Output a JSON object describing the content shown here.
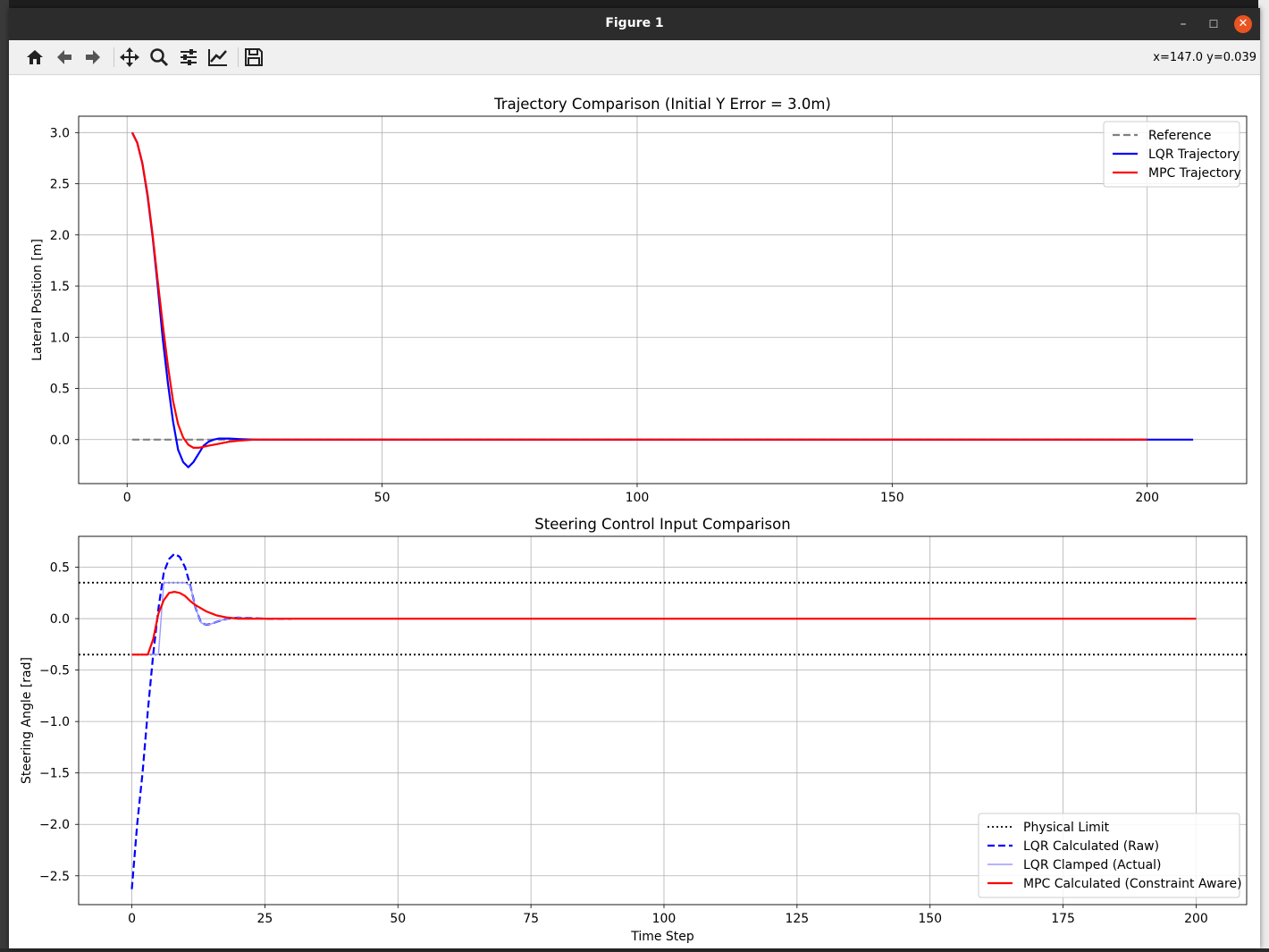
{
  "window": {
    "title": "Figure 1",
    "minimize_glyph": "–",
    "maximize_glyph": "☐",
    "close_glyph": "✕"
  },
  "toolbar": {
    "buttons": [
      "home-icon",
      "back-icon",
      "forward-icon",
      "pan-icon",
      "zoom-icon",
      "configure-subplots-icon",
      "edit-axis-icon",
      "save-icon"
    ],
    "coords": "x=147.0 y=0.039"
  },
  "chart_data": [
    {
      "type": "line",
      "title": "Trajectory Comparison (Initial Y Error = 3.0m)",
      "xlabel": "",
      "ylabel": "Lateral Position [m]",
      "xlim": [
        -9.5,
        219.5
      ],
      "ylim": [
        -0.43,
        3.16
      ],
      "xticks": [
        "0",
        "50",
        "100",
        "150",
        "200"
      ],
      "xtick_values": [
        0,
        50,
        100,
        150,
        200
      ],
      "yticks": [
        "0.0",
        "0.5",
        "1.0",
        "1.5",
        "2.0",
        "2.5",
        "3.0"
      ],
      "ytick_values": [
        0,
        0.5,
        1.0,
        1.5,
        2.0,
        2.5,
        3.0
      ],
      "grid": true,
      "legend_position": "top-right",
      "series": [
        {
          "name": "Reference",
          "color": "#808080",
          "style": "dashed",
          "x": [
            1,
            200
          ],
          "y": [
            0,
            0
          ]
        },
        {
          "name": "LQR Trajectory",
          "color": "#0000ff",
          "style": "solid",
          "x": [
            1,
            2,
            3,
            4,
            5,
            6,
            7,
            8,
            9,
            10,
            11,
            12,
            13,
            14,
            15,
            16,
            17,
            18,
            20,
            22,
            25,
            30,
            209
          ],
          "y": [
            3.0,
            2.9,
            2.7,
            2.38,
            1.98,
            1.5,
            0.98,
            0.55,
            0.18,
            -0.1,
            -0.22,
            -0.27,
            -0.22,
            -0.14,
            -0.06,
            -0.02,
            0.0,
            0.01,
            0.01,
            0.005,
            0.0,
            0.0,
            0.0
          ]
        },
        {
          "name": "MPC Trajectory",
          "color": "#ff0000",
          "style": "solid",
          "x": [
            1,
            2,
            3,
            4,
            5,
            6,
            7,
            8,
            9,
            10,
            11,
            12,
            13,
            14,
            15,
            16,
            18,
            20,
            22,
            25,
            28,
            200
          ],
          "y": [
            3.0,
            2.9,
            2.7,
            2.4,
            2.0,
            1.55,
            1.12,
            0.72,
            0.38,
            0.15,
            0.02,
            -0.05,
            -0.08,
            -0.08,
            -0.07,
            -0.06,
            -0.04,
            -0.02,
            -0.01,
            0.0,
            0.0,
            0.0
          ]
        }
      ]
    },
    {
      "type": "line",
      "title": "Steering Control Input Comparison",
      "xlabel": "Time Step",
      "ylabel": "Steering Angle [rad]",
      "xlim": [
        -10,
        209.5
      ],
      "ylim": [
        -2.78,
        0.8
      ],
      "xticks": [
        "0",
        "25",
        "50",
        "75",
        "100",
        "125",
        "150",
        "175",
        "200"
      ],
      "xtick_values": [
        0,
        25,
        50,
        75,
        100,
        125,
        150,
        175,
        200
      ],
      "yticks": [
        "−2.5",
        "−2.0",
        "−1.5",
        "−1.0",
        "−0.5",
        "0.0",
        "0.5"
      ],
      "ytick_values": [
        -2.5,
        -2.0,
        -1.5,
        -1.0,
        -0.5,
        0.0,
        0.5
      ],
      "grid": true,
      "legend_position": "bottom-right",
      "series": [
        {
          "name": "Physical Limit",
          "color": "#000000",
          "style": "dotted",
          "x": [
            -10,
            209.5
          ],
          "y": [
            0.35,
            0.35
          ]
        },
        {
          "name": "",
          "color": "#000000",
          "style": "dotted",
          "x": [
            -10,
            209.5
          ],
          "y": [
            -0.35,
            -0.35
          ]
        },
        {
          "name": "LQR Calculated (Raw)",
          "color": "#0000ff",
          "style": "dashed",
          "x": [
            0,
            1,
            2,
            3,
            4,
            5,
            6,
            7,
            8,
            9,
            10,
            11,
            12,
            13,
            14,
            15,
            16,
            18,
            20,
            25,
            30
          ],
          "y": [
            -2.63,
            -2.0,
            -1.5,
            -0.9,
            -0.35,
            0.1,
            0.45,
            0.58,
            0.63,
            0.6,
            0.5,
            0.32,
            0.1,
            -0.04,
            -0.06,
            -0.05,
            -0.03,
            0.0,
            0.01,
            0.0,
            0.0
          ]
        },
        {
          "name": "LQR Clamped (Actual)",
          "color": "#9a9aff",
          "style": "solid",
          "x": [
            0,
            3,
            4,
            5,
            6,
            7,
            8,
            9,
            10,
            11,
            12,
            13,
            14,
            15,
            16,
            18,
            20,
            25
          ],
          "y": [
            -0.35,
            -0.35,
            -0.35,
            -0.35,
            0.35,
            0.35,
            0.35,
            0.35,
            0.35,
            0.32,
            0.1,
            -0.04,
            -0.06,
            -0.05,
            -0.03,
            0.0,
            0.01,
            0.0
          ]
        },
        {
          "name": "MPC Calculated (Constraint Aware)",
          "color": "#ff0000",
          "style": "solid",
          "x": [
            0,
            1,
            2,
            3,
            4,
            5,
            6,
            7,
            8,
            9,
            10,
            11,
            12,
            13,
            14,
            15,
            16,
            18,
            20,
            22,
            25,
            200
          ],
          "y": [
            -0.35,
            -0.35,
            -0.35,
            -0.35,
            -0.2,
            0.05,
            0.18,
            0.25,
            0.26,
            0.25,
            0.22,
            0.17,
            0.13,
            0.1,
            0.07,
            0.05,
            0.03,
            0.01,
            0.0,
            0.0,
            0.0,
            0.0
          ]
        }
      ]
    }
  ]
}
